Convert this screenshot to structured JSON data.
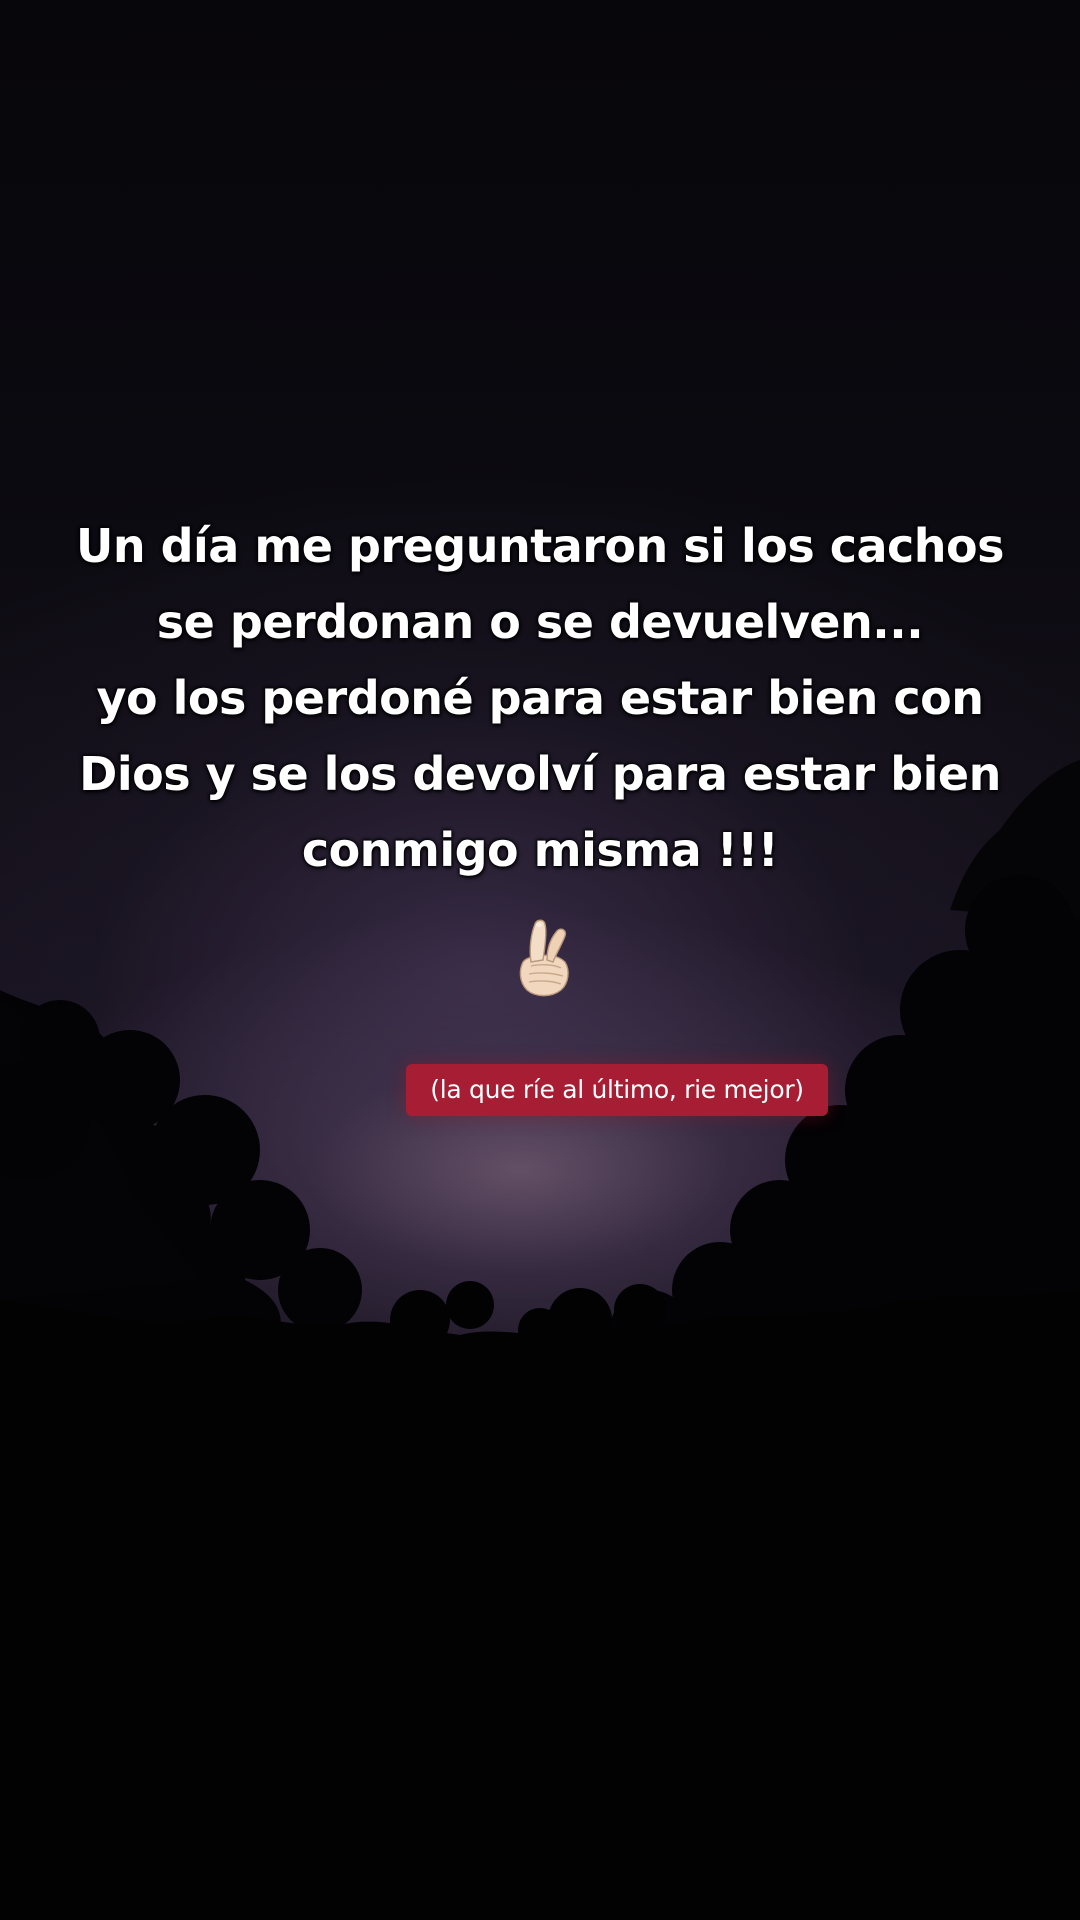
{
  "quote": {
    "lines": [
      "Un día me preguntaron si los cachos",
      "se perdonan o se devuelven...",
      "yo los perdoné para estar bien con",
      "Dios y se los devolví para estar bien",
      "conmigo misma !!!"
    ]
  },
  "emoji": {
    "icon": "crossed-fingers-heart-hand-icon"
  },
  "caption": {
    "text": "(la que ríe al último, rie mejor)",
    "background": "#a71d33"
  },
  "colors": {
    "sky_dark": "#07060a",
    "sky_glow": "#6e5870",
    "foliage": "#020203",
    "text": "#ffffff"
  }
}
